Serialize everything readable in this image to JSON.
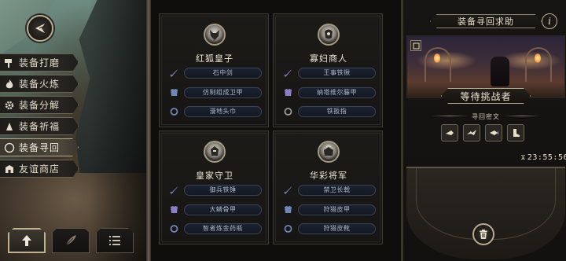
{
  "side_menu": {
    "items": [
      {
        "label": "装备打磨",
        "icon": "hammer-icon"
      },
      {
        "label": "装备火炼",
        "icon": "flame-icon"
      },
      {
        "label": "装备分解",
        "icon": "gear-icon"
      },
      {
        "label": "装备祈福",
        "icon": "hands-icon"
      },
      {
        "label": "装备寻回",
        "icon": "compass-icon",
        "active": true
      },
      {
        "label": "友谊商店",
        "icon": "shop-icon"
      }
    ]
  },
  "bottom_nav": [
    {
      "icon": "upgrade-arrow-icon",
      "active": true
    },
    {
      "icon": "feather-icon"
    },
    {
      "icon": "list-icon"
    }
  ],
  "cards": [
    {
      "title": "红狐皇子",
      "items": [
        {
          "label": "石中剑",
          "icon": "sword-icon"
        },
        {
          "label": "仿制组成卫甲",
          "icon": "armor-icon"
        },
        {
          "label": "漫地头巾",
          "icon": "ring-icon"
        }
      ]
    },
    {
      "title": "寡妇商人",
      "items": [
        {
          "label": "王事铁锹",
          "icon": "sword-icon"
        },
        {
          "label": "纳塔维尔藤甲",
          "icon": "armor-icon"
        },
        {
          "label": "铁扳指",
          "icon": "ring-icon"
        }
      ]
    },
    {
      "title": "皇家守卫",
      "items": [
        {
          "label": "御兵铁锤",
          "icon": "sword-icon"
        },
        {
          "label": "大鳞骨甲",
          "icon": "armor-icon"
        },
        {
          "label": "智者炼金药瓶",
          "icon": "ring-icon"
        }
      ]
    },
    {
      "title": "华彩将军",
      "items": [
        {
          "label": "禁卫长戟",
          "icon": "sword-icon"
        },
        {
          "label": "狩猎皮甲",
          "icon": "armor-icon"
        },
        {
          "label": "狩猎皮靴",
          "icon": "ring-icon"
        }
      ]
    }
  ],
  "right_panel": {
    "header": "装备寻回求助",
    "info_glyph": "i",
    "banner": "等待挑战者",
    "cipher_title": "寻回密文",
    "timer": "23:55:56"
  },
  "colors": {
    "accent": "#b9ab8e",
    "pill_bg": "#1b2230",
    "pill_text": "#aeb8cc"
  }
}
